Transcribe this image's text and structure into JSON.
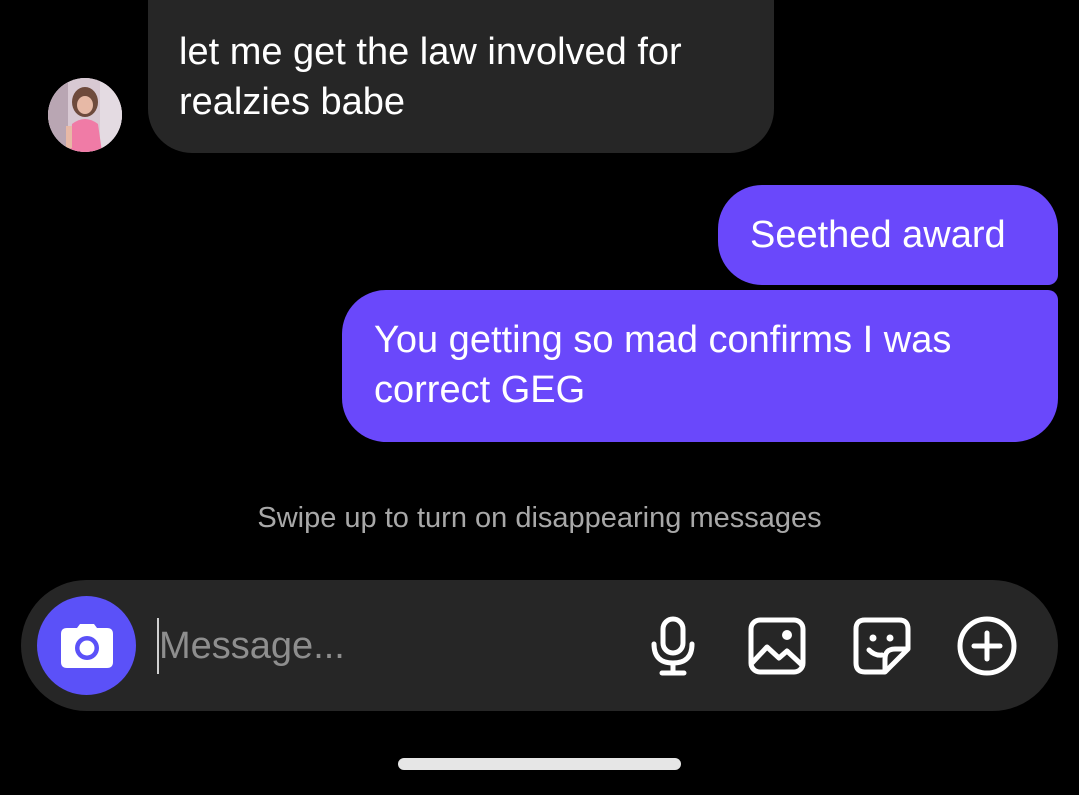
{
  "conversation": {
    "messages": [
      {
        "direction": "incoming",
        "text": "let me get the law involved for realzies babe"
      },
      {
        "direction": "outgoing",
        "text": "Seethed award"
      },
      {
        "direction": "outgoing",
        "text": "You getting so mad confirms I was correct GEG"
      }
    ],
    "disappearing_hint": "Swipe up to turn on disappearing messages"
  },
  "composer": {
    "placeholder": "Message...",
    "value": "",
    "icons": {
      "camera": "camera-icon",
      "mic": "microphone-icon",
      "gallery": "image-gallery-icon",
      "sticker": "sticker-icon",
      "plus": "plus-circle-icon"
    }
  },
  "colors": {
    "background": "#000000",
    "incoming_bubble": "#262626",
    "outgoing_bubble": "#6a48fb",
    "camera_button": "#5b51f8",
    "hint_text": "#a8a8a8"
  }
}
